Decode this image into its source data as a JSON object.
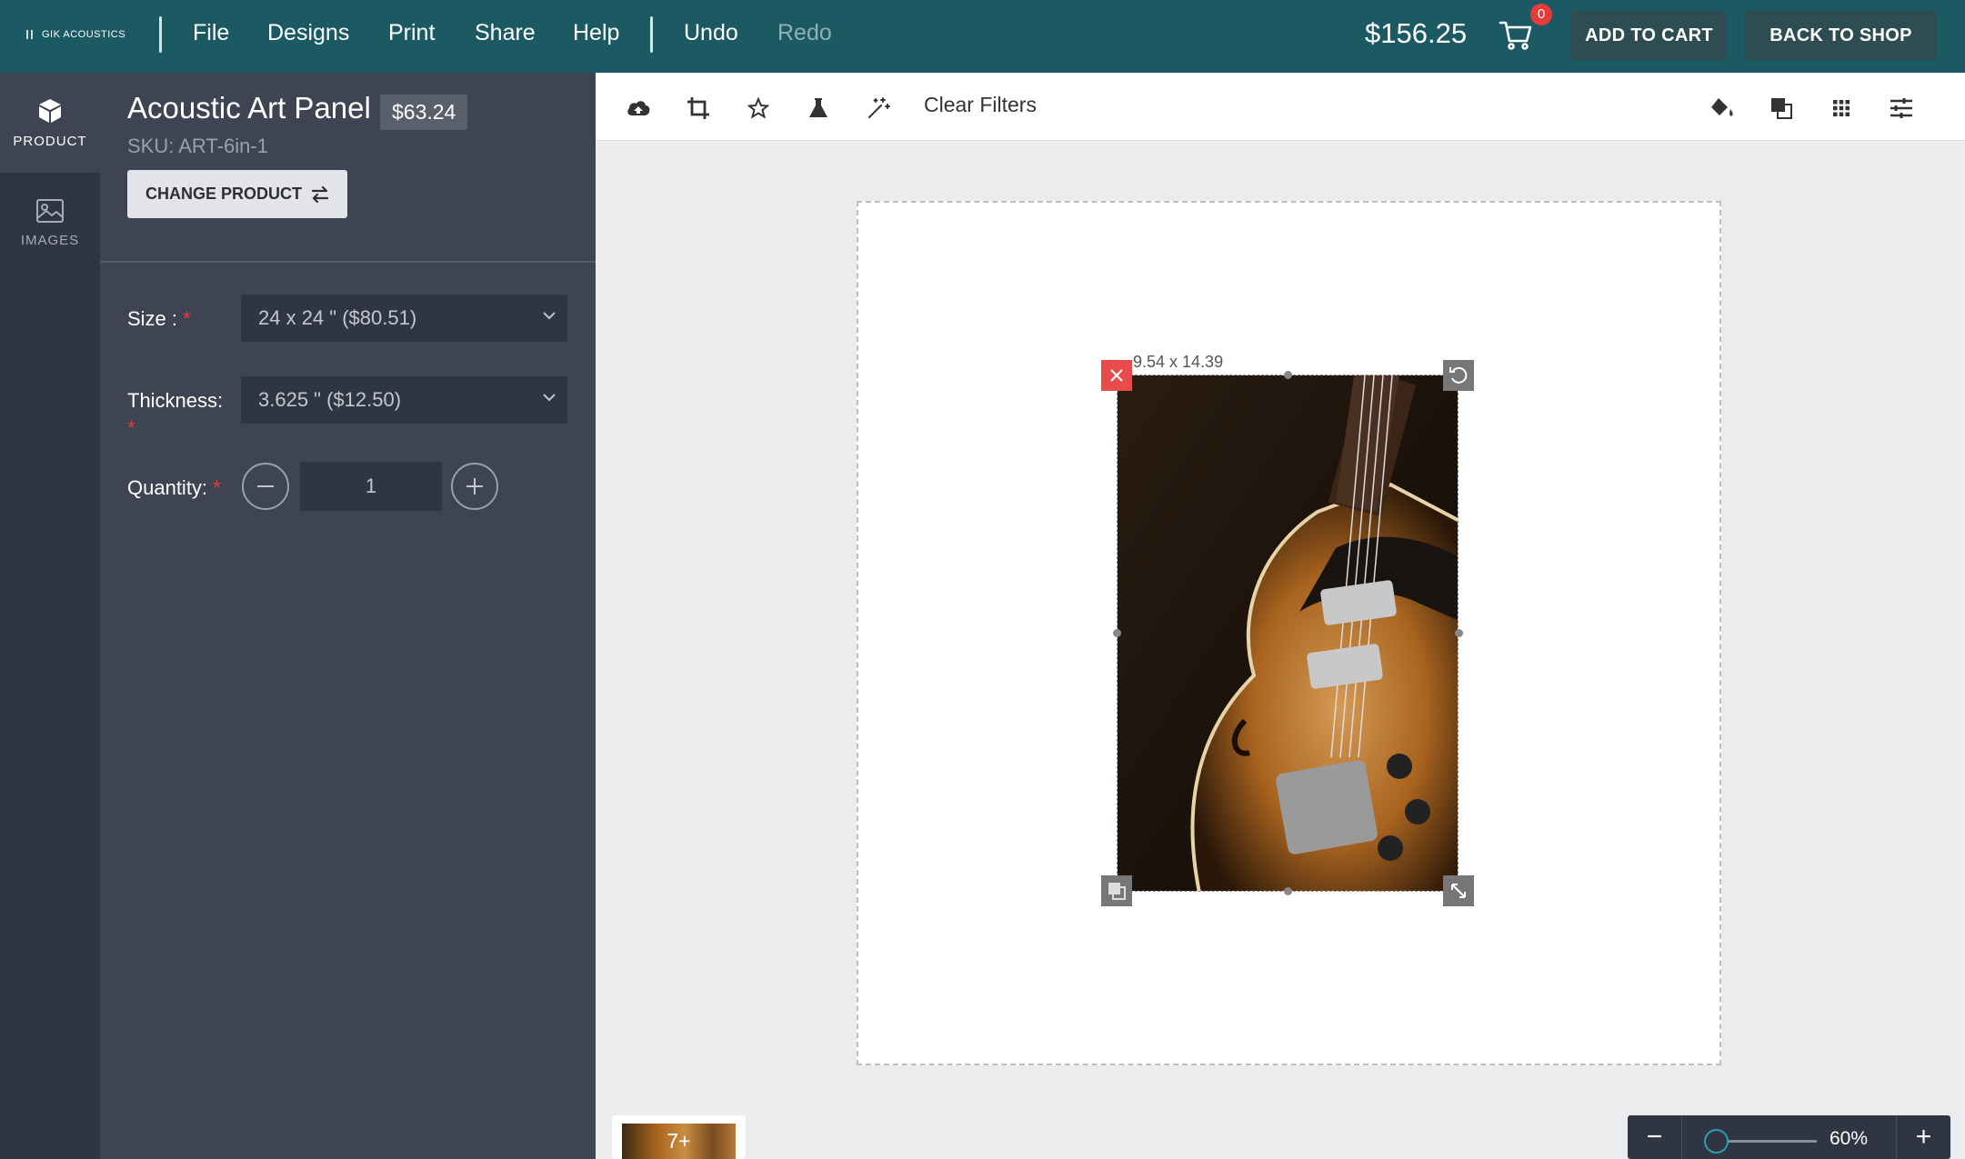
{
  "header": {
    "logo_text": "GIK ACOUSTICS",
    "menu": [
      "File",
      "Designs",
      "Print",
      "Share",
      "Help"
    ],
    "undo_label": "Undo",
    "redo_label": "Redo",
    "total": "$156.25",
    "cart_count": "0",
    "add_to_cart_label": "ADD TO CART",
    "back_to_shop_label": "BACK TO SHOP",
    "colors": {
      "bar": "#1b5a63",
      "button": "#2e4d52",
      "badge": "#e63b3b"
    }
  },
  "rail": {
    "items": [
      {
        "label": "PRODUCT",
        "icon": "box-icon"
      },
      {
        "label": "IMAGES",
        "icon": "image-icon"
      }
    ]
  },
  "product": {
    "title": "Acoustic Art Panel",
    "price": "$63.24",
    "sku": "SKU: ART-6in-1",
    "change_label": "CHANGE PRODUCT",
    "size_label": "Size :",
    "size_value": "24 x 24 \" ($80.51)",
    "thickness_label": "Thickness:",
    "thickness_value": "3.625 \" ($12.50)",
    "quantity_label": "Quantity:",
    "quantity_value": "1",
    "required_mark": "*"
  },
  "toolbar": {
    "left_tools": [
      "upload-icon",
      "crop-icon",
      "star-icon",
      "flask-icon",
      "magic-wand-icon"
    ],
    "clear_filters_label": "Clear Filters",
    "right_tools": [
      "fill-color-icon",
      "layer-icon",
      "grid-icon",
      "sliders-icon"
    ]
  },
  "canvas": {
    "image_dimensions": "9.54 x 14.39",
    "image_subject": "electric guitar photo"
  },
  "footer": {
    "thumb_more": "7+",
    "zoom_value": "60%",
    "zoom_minus": "−",
    "zoom_plus": "+"
  }
}
